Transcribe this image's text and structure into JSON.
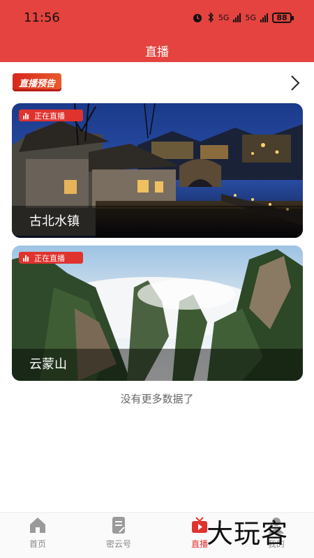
{
  "status_bar": {
    "time": "11:56",
    "network1": "5G",
    "network2": "5G",
    "battery": "88"
  },
  "header": {
    "title": "直播"
  },
  "section": {
    "badge_label": "直播预告"
  },
  "live_cards": [
    {
      "status": "正在直播",
      "name": "古北水镇"
    },
    {
      "status": "正在直播",
      "name": "云蒙山"
    }
  ],
  "list_end_text": "没有更多数据了",
  "bottom_nav": {
    "items": [
      {
        "label": "首页",
        "icon": "home-icon"
      },
      {
        "label": "密云号",
        "icon": "document-icon"
      },
      {
        "label": "直播",
        "icon": "tv-icon"
      },
      {
        "label": "我的",
        "icon": "user-icon"
      }
    ],
    "active_index": 2
  },
  "watermark_text": "大玩客",
  "colors": {
    "brand_red": "#e4433f",
    "live_red": "#e0332e"
  }
}
